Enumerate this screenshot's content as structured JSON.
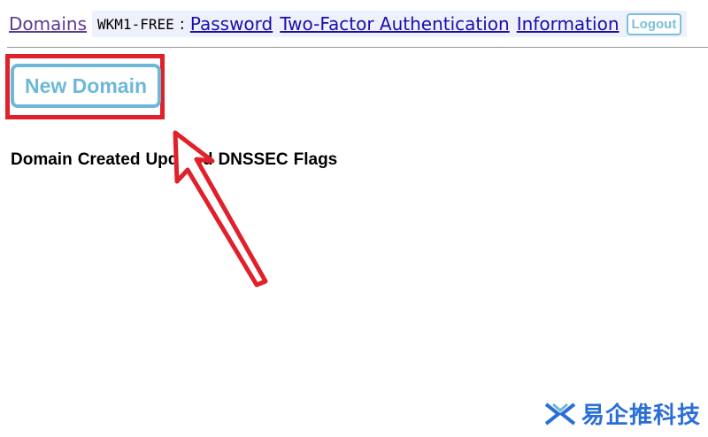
{
  "nav": {
    "domains_label": "Domains",
    "username": "WKM1-FREE",
    "separator": ":",
    "password_label": "Password",
    "twofa_label": "Two-Factor Authentication",
    "information_label": "Information",
    "logout_label": "Logout"
  },
  "main": {
    "new_domain_label": "New Domain",
    "table_headers": [
      "Domain",
      "Created",
      "Updated",
      "DNSSEC",
      "Flags"
    ]
  },
  "watermark": {
    "text": "易企推科技",
    "logo_icon": "xx-logo-icon"
  },
  "colors": {
    "annotation_red": "#e0202a",
    "button_blue": "#6db8d8",
    "link_purple": "#5b3a91",
    "link_blue": "#1a0dab"
  }
}
